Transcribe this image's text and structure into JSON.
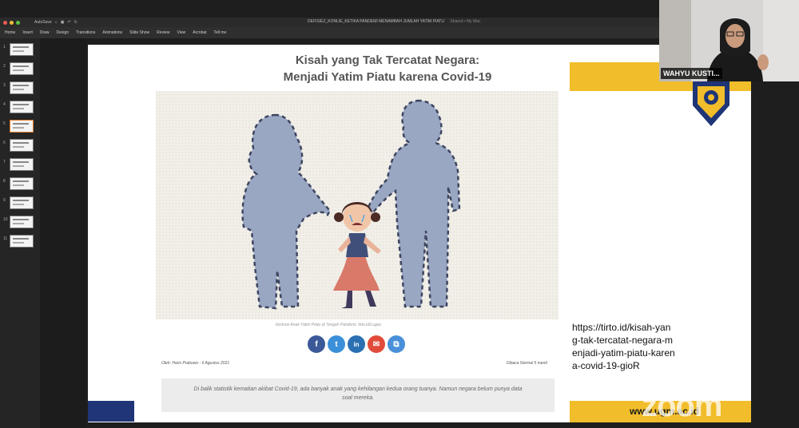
{
  "app": {
    "window_title": "DEFISIEZ_KONLIE_KETIKA PANDEMI MENAMBAH JUMLAH YATIM PIATU",
    "shared_label": "Shared • My Mac",
    "autosave_label": "AutoSave"
  },
  "ribbon": {
    "tabs": [
      "Home",
      "Insert",
      "Draw",
      "Design",
      "Transitions",
      "Animations",
      "Slide Show",
      "Review",
      "View",
      "Acrobat",
      "Tell me"
    ]
  },
  "thumbnails": {
    "numbers": [
      "1",
      "2",
      "3",
      "4",
      "5",
      "6",
      "7",
      "8",
      "9",
      "10",
      "11"
    ],
    "active_index": 5
  },
  "slide": {
    "headline": "Kisah yang Tak Tercatat Negara: Menjadi Yatim Piatu karena Covid-19",
    "caption": "Ilustrasi Anak Yatim Piatu di Tengah Pandemi. tirto.id/Lugas",
    "byline": "Oleh: Haris Prabowo - 6 Agustus 2021",
    "read_time": "Dibaca Normal 5 menit",
    "quote": "Di balik statistik kematian akibat Covid-19, ada banyak anak yang kehilangan kedua orang tuanya. Namun negara belum punya data soal mereka.",
    "share_icons": [
      {
        "label": "f",
        "name": "facebook-icon",
        "color": "#3b5998"
      },
      {
        "label": "t",
        "name": "twitter-icon",
        "color": "#3a8fd8"
      },
      {
        "label": "in",
        "name": "linkedin-icon",
        "color": "#2b70b3"
      },
      {
        "label": "✉",
        "name": "email-icon",
        "color": "#e14c3a"
      },
      {
        "label": "⧉",
        "name": "copy-link-icon",
        "color": "#4a90d9"
      }
    ],
    "url": "https://tirto.id/kisah-yang-tak-tercatat-negara-menjadi-yatim-piatu-karena-covid-19-gioR",
    "website": "www.ugm.ac.id"
  },
  "webcam": {
    "participant_name": "WAHYU KUSTI..."
  },
  "watermark": "zoom",
  "colors": {
    "accent_yellow": "#f1bd2a",
    "accent_blue": "#1f3577",
    "silhouette": "#9aa7c3"
  }
}
